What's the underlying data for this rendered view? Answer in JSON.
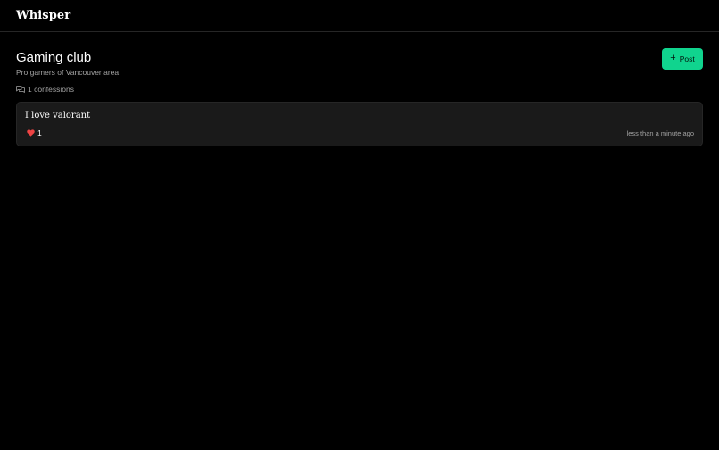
{
  "app": {
    "brand": "Whisper"
  },
  "club": {
    "title": "Gaming club",
    "description": "Pro gamers of Vancouver area",
    "confessions_count": "1 confessions"
  },
  "actions": {
    "post_label": "Post"
  },
  "confessions": [
    {
      "text": "I love valorant",
      "likes": "1",
      "time": "less than a minute ago"
    }
  ],
  "colors": {
    "accent": "#10d48e",
    "heart": "#ef4444",
    "card_bg": "#1a1a1a"
  },
  "icons": {
    "count": "chat-bubbles-icon",
    "like": "heart-icon",
    "post": "plus-icon"
  }
}
